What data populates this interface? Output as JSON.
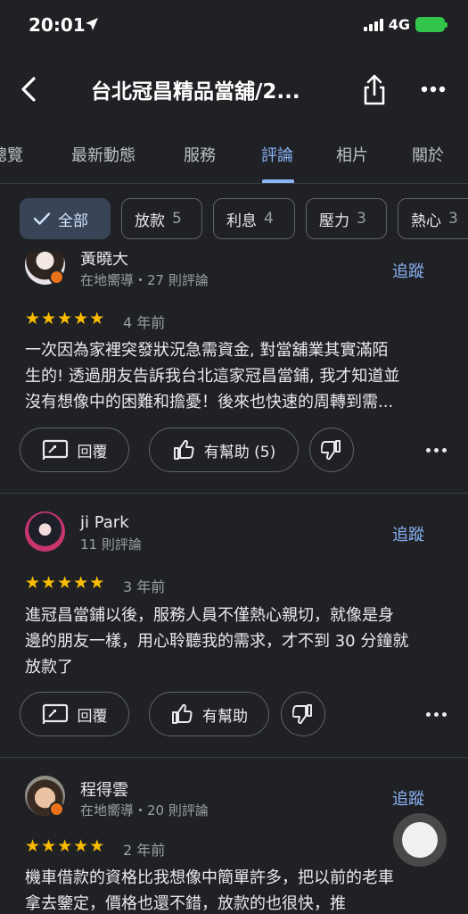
{
  "status": {
    "time": "20:01",
    "network": "4G"
  },
  "header": {
    "title": "台北冠昌精品當舖/2..."
  },
  "tabs": [
    {
      "label": "總覽"
    },
    {
      "label": "最新動態"
    },
    {
      "label": "服務"
    },
    {
      "label": "評論"
    },
    {
      "label": "相片"
    },
    {
      "label": "關於"
    }
  ],
  "active_tab": "評論",
  "filters": [
    {
      "label": "全部",
      "count": ""
    },
    {
      "label": "放款",
      "count": "5"
    },
    {
      "label": "利息",
      "count": "4"
    },
    {
      "label": "壓力",
      "count": "3"
    },
    {
      "label": "熱心",
      "count": "3"
    }
  ],
  "reviews": [
    {
      "name": "黃曉大",
      "meta": "在地嚮導・27 則評論",
      "follow": "追蹤",
      "rating": 5,
      "date": "4 年前",
      "lines": [
        "一次因為家裡突發狀況急需資金, 對當舖業其實滿陌",
        "生的! 透過朋友告訴我台北這家冠昌當鋪, 我才知道並",
        "沒有想像中的困難和擔憂！後來也快速的周轉到需..."
      ],
      "reply": "回覆",
      "helpful": "有幫助 (5)"
    },
    {
      "name": "ji Park",
      "meta": "11 則評論",
      "follow": "追蹤",
      "rating": 5,
      "date": "3 年前",
      "lines": [
        "進冠昌當鋪以後，服務人員不僅熱心親切，就像是身",
        "邊的朋友一樣，用心聆聽我的需求，才不到 30 分鐘就",
        "放款了"
      ],
      "reply": "回覆",
      "helpful": "有幫助"
    },
    {
      "name": "程得雲",
      "meta": "在地嚮導・20 則評論",
      "follow": "追蹤",
      "rating": 5,
      "date": "2 年前",
      "lines": [
        "機車借款的資格比我想像中簡單許多，把以前的老車",
        "拿去鑒定，價格也還不錯，放款的也很快，推"
      ],
      "reply": "",
      "helpful": ""
    }
  ],
  "colors": {
    "accent": "#8ab4f8",
    "star": "#fbbc04",
    "background": "#202124"
  }
}
